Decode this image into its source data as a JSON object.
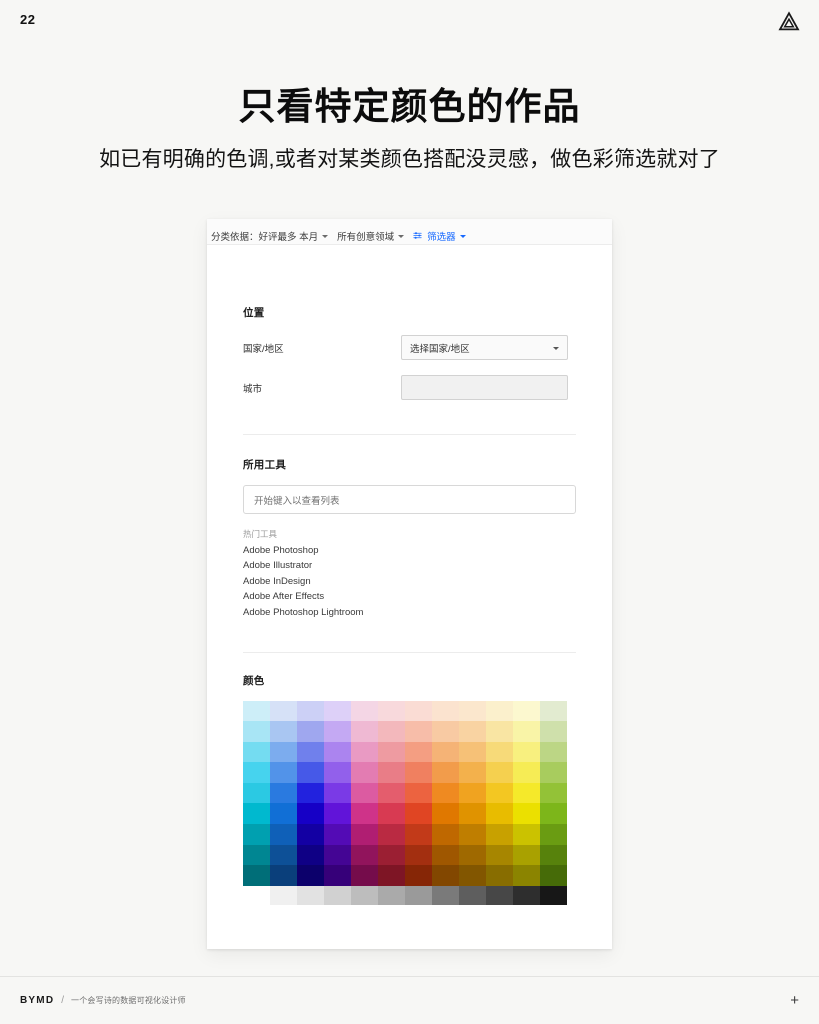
{
  "page": {
    "number": "22",
    "logo_icon": "triangle-logo-icon"
  },
  "headline": "只看特定颜色的作品",
  "subhead": "如已有明确的色调,或者对某类颜色搭配没灵感，做色彩筛选就对了",
  "ui": {
    "filter_bar": {
      "sort_label": "分类依据：好评最多 本月",
      "field_label": "所有创意领域",
      "filter_label": "筛选器",
      "filter_icon": "sliders-filter-icon",
      "accent_color": "#1769ff"
    },
    "location": {
      "title": "位置",
      "country_label": "国家/地区",
      "country_value": "选择国家/地区",
      "city_label": "城市",
      "city_value": ""
    },
    "tools": {
      "title": "所用工具",
      "input_placeholder": "开始键入以查看列表",
      "group_title": "热门工具",
      "items": [
        "Adobe Photoshop",
        "Adobe Illustrator",
        "Adobe InDesign",
        "Adobe After Effects",
        "Adobe Photoshop Lightroom"
      ]
    },
    "color": {
      "title": "颜色",
      "columns": 12,
      "rows": 9,
      "swatches": [
        [
          "#cdeef8",
          "#d6e1f7",
          "#ccd0f6",
          "#ddd0f8",
          "#f4d6e5",
          "#f8d9dc",
          "#fadcd4",
          "#fbe3cf",
          "#fbe7cd",
          "#fbf0cc",
          "#fcf8cf",
          "#e2ebd0"
        ],
        [
          "#a8e5f5",
          "#a9c6f2",
          "#9fa7ef",
          "#c4a9f3",
          "#efb9d3",
          "#f3b8bc",
          "#f7bda9",
          "#f8caa3",
          "#f9d3a2",
          "#f9e5a3",
          "#f9f4a7",
          "#cfe0ab"
        ],
        [
          "#74dcf1",
          "#7cacee",
          "#7080ec",
          "#ab84ef",
          "#e99ac3",
          "#ee9ba1",
          "#f49e82",
          "#f5b376",
          "#f6c177",
          "#f7da79",
          "#f8f07f",
          "#bcd685"
        ],
        [
          "#46d3ee",
          "#5293e9",
          "#4659e8",
          "#9260eb",
          "#e37cb2",
          "#e97d87",
          "#f08060",
          "#f29c4b",
          "#f3b14c",
          "#f5d04f",
          "#f6ec55",
          "#a8cc5e"
        ],
        [
          "#2bc9e3",
          "#2a7ae0",
          "#2222de",
          "#7a3ae6",
          "#dc5ba1",
          "#e45d6d",
          "#ec6340",
          "#ef8a21",
          "#f0a320",
          "#f3c722",
          "#f5e92a",
          "#93c237"
        ],
        [
          "#00b9cf",
          "#116fd6",
          "#1600c6",
          "#6114d9",
          "#cf3389",
          "#d83a52",
          "#e04523",
          "#e07800",
          "#e09300",
          "#e8bc00",
          "#ebe000",
          "#7db61a"
        ],
        [
          "#00a0b0",
          "#0f60b8",
          "#1300a3",
          "#530bb5",
          "#b01e72",
          "#ba2a42",
          "#c23a19",
          "#bf6800",
          "#bf7e00",
          "#c8a100",
          "#cbc200",
          "#6a9c12"
        ],
        [
          "#008692",
          "#0d5097",
          "#0f0085",
          "#440594",
          "#91145c",
          "#9b1f33",
          "#a32f10",
          "#9f5700",
          "#9f6900",
          "#a78600",
          "#a9a100",
          "#57820c"
        ],
        [
          "#006e78",
          "#0a3f7b",
          "#0c006b",
          "#360079",
          "#750c4b",
          "#7e1525",
          "#862606",
          "#824700",
          "#825600",
          "#886d00",
          "#8b8400",
          "#466b08"
        ]
      ],
      "grayscale": [
        "#f0f0f0",
        "#e2e2e2",
        "#d1d1d1",
        "#bdbdbd",
        "#aaaaaa",
        "#9a9a9a",
        "#7a7a7a",
        "#5e5e5e",
        "#474747",
        "#2e2e2e",
        "#171717"
      ]
    }
  },
  "footer": {
    "brand": "BYMD",
    "separator": "/",
    "tagline": "一个会写诗的数据可视化设计师",
    "plus_icon": "plus-icon"
  }
}
